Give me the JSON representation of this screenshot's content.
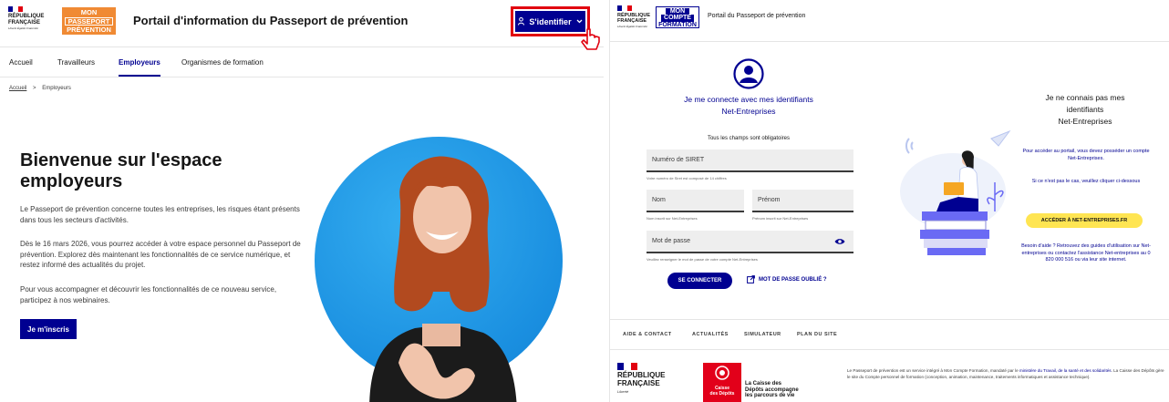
{
  "left": {
    "header": {
      "rf_line1": "RÉPUBLIQUE",
      "rf_line2": "FRANÇAISE",
      "rf_motto": "Liberté Égalité Fraternité",
      "logo_line1": "MON",
      "logo_line2": "PASSEPORT",
      "logo_line3": "PRÉVENTION",
      "title": "Portail d'information du Passeport de prévention",
      "login_button": "S'identifier"
    },
    "nav": [
      "Accueil",
      "Travailleurs",
      "Employeurs",
      "Organismes de formation"
    ],
    "breadcrumb": {
      "home": "Accueil",
      "sep": ">",
      "current": "Employeurs"
    },
    "hero": {
      "title": "Bienvenue sur l'espace employeurs",
      "p1": "Le Passeport de prévention concerne toutes les entreprises, les risques étant présents dans tous les secteurs d'activités.",
      "p2": "Dès le 16 mars 2026, vous pourrez accéder à votre espace personnel du Passeport de prévention. Explorez dès maintenant les fonctionnalités de ce service numérique, et restez informé des actualités du projet.",
      "p3": "Pour vous accompagner et découvrir les fonctionnalités de ce nouveau service, participez à nos webinaires.",
      "cta": "Je m'inscris"
    }
  },
  "right": {
    "header": {
      "rf_line1": "RÉPUBLIQUE",
      "rf_line2": "FRANÇAISE",
      "rf_motto": "Liberté Égalité Fraternité",
      "logo_line1": "MON",
      "logo_line2": "COMPTE",
      "logo_line3": "FORMATION",
      "title": "Portail du Passeport de prévention"
    },
    "login": {
      "title_line1": "Je me connecte avec mes identifiants",
      "title_line2": "Net-Entreprises",
      "required": "Tous les champs sont obligatoires",
      "siret_placeholder": "Numéro de SIRET",
      "siret_hint": "Votre numéro de Siret est composé de 14 chiffres",
      "nom_placeholder": "Nom",
      "nom_hint": "Nom inscrit sur Net-Entreprises",
      "prenom_placeholder": "Prénom",
      "prenom_hint": "Prénom inscrit sur Net-Entreprises",
      "password_placeholder": "Mot de passe",
      "password_hint": "Veuillez renseigner le mot de passe de votre compte Net-Entreprises",
      "connect_button": "SE CONNECTER",
      "forgot_link": "MOT DE PASSE OUBLIÉ ?"
    },
    "unknown": {
      "title_line1": "Je ne connais pas mes",
      "title_line2": "identifiants",
      "title_line3": "Net-Entreprises",
      "p1": "Pour accéder au portail, vous devez posséder un compte Net-Entreprises.",
      "p2": "Si ce n'est pas le cas, veuillez cliquer ci-dessous",
      "button": "ACCÉDER À NET-ENTREPRISES.FR",
      "p3": "Besoin d'aide ? Retrouvez des guides d'utilisation sur Net-entreprises ou contactez l'assistance Net-entreprises au 0 820 000 516 ou via leur site internet."
    },
    "footer": {
      "links": [
        "AIDE & CONTACT",
        "ACTUALITÉS",
        "SIMULATEUR",
        "PLAN DU SITE"
      ],
      "rf_line1": "RÉPUBLIQUE",
      "rf_line2": "FRANÇAISE",
      "rf_motto": "Liberté",
      "cdc_logo_line1": "Caisse",
      "cdc_logo_line2": "des Dépôts",
      "cdc_text": "La Caisse des Dépôts accompagne les parcours de vie",
      "text_part1": "Le Passeport de prévention est un service intégré à Mon Compte Formation, mandaté par le ",
      "text_link": "ministère du Travail, de la santé et des solidarités",
      "text_part2": ". La Caisse des Dépôts gère le site du Compte personnel de formation (conception, animation, maintenance, traitements informatiques et assistance technique)."
    }
  },
  "colors": {
    "brand_blue": "#000091",
    "marianne_red": "#e1000f",
    "orange_logo": "#f08a34",
    "yellow_button": "#ffe552",
    "cdc_red": "#e2001a"
  }
}
